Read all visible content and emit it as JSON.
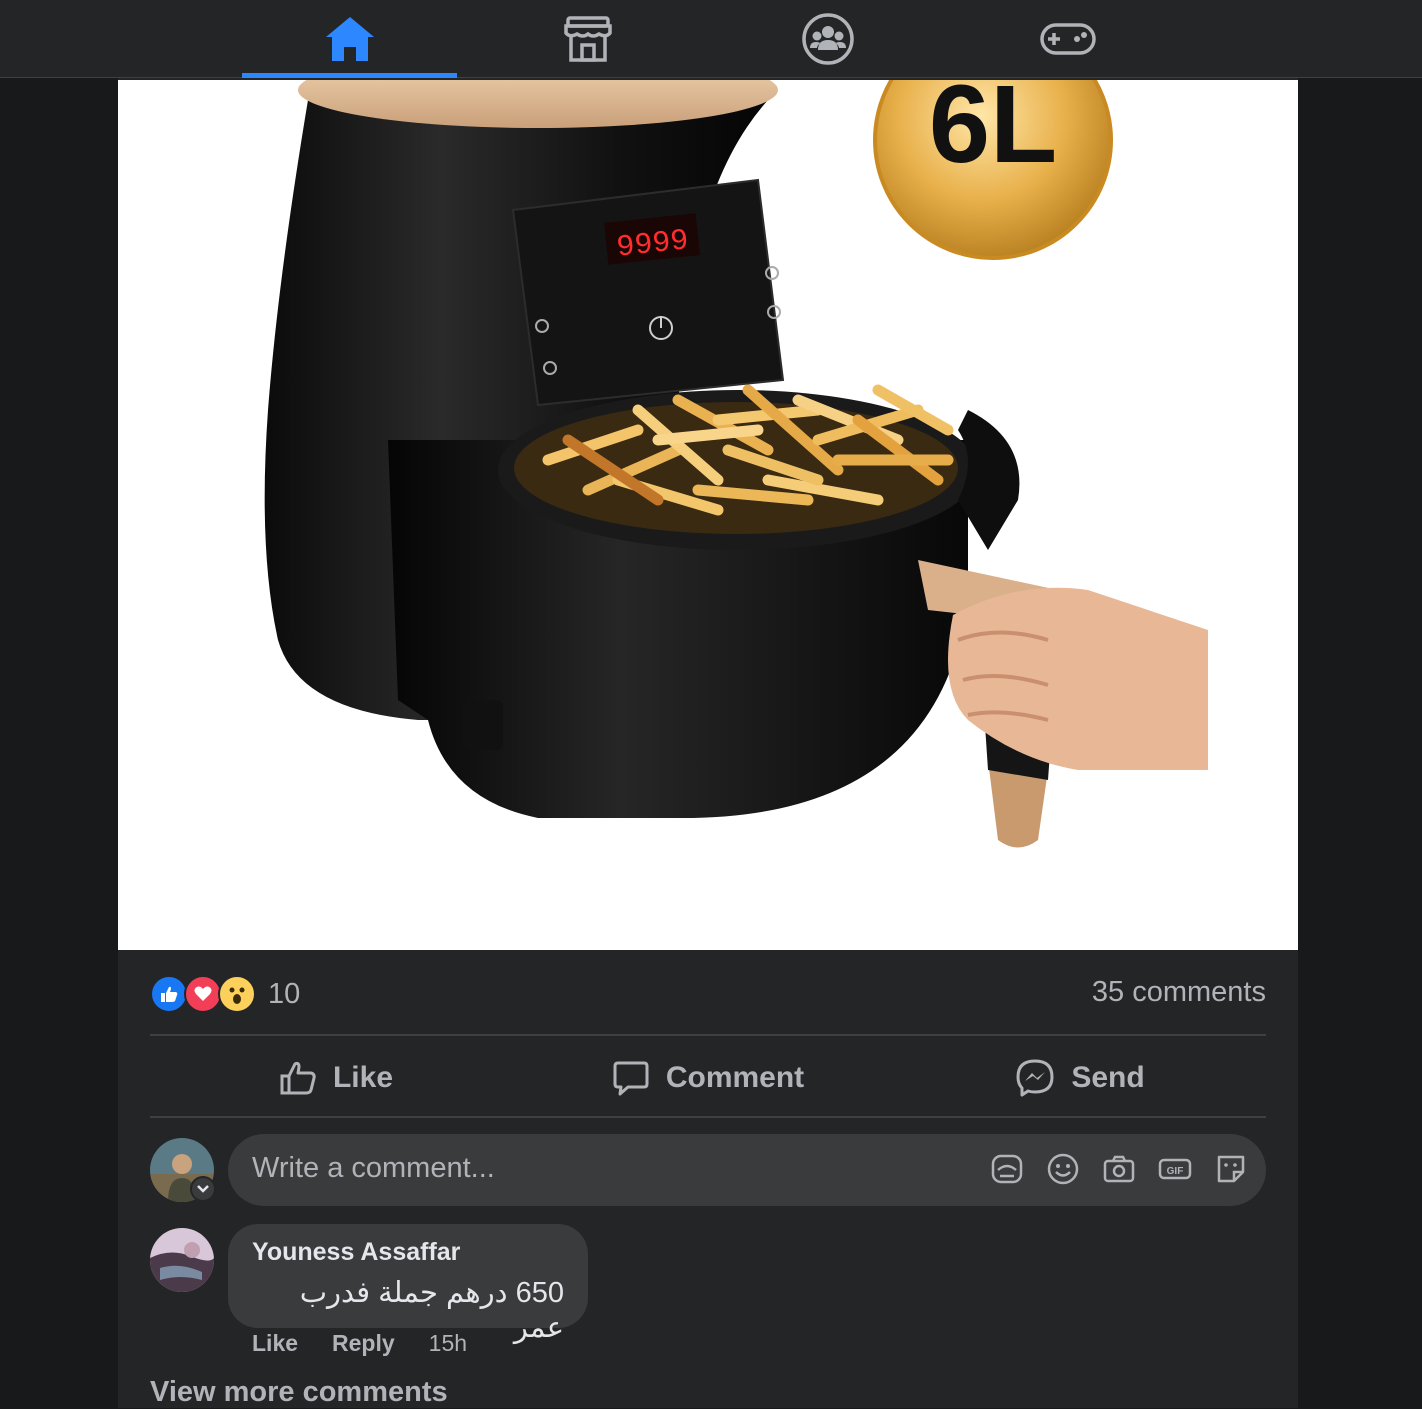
{
  "nav": {
    "tabs": [
      {
        "name": "home",
        "icon": "home-icon",
        "active": true
      },
      {
        "name": "marketplace",
        "icon": "marketplace-store-icon",
        "active": false
      },
      {
        "name": "groups",
        "icon": "groups-icon",
        "active": false
      },
      {
        "name": "gaming",
        "icon": "gaming-controller-icon",
        "active": false
      }
    ],
    "active_color": "#2d88ff"
  },
  "post": {
    "photo": {
      "display_readout": "9999",
      "capacity_badge": "6L"
    },
    "reactions": [
      "like-reaction-icon",
      "love-reaction-icon",
      "wow-reaction-icon"
    ],
    "reaction_count": "10",
    "comments_count": "35 comments",
    "actions": {
      "like": "Like",
      "comment": "Comment",
      "send": "Send"
    }
  },
  "composer": {
    "placeholder": "Write a comment...",
    "icons": [
      "avatar-sticker-icon",
      "emoji-icon",
      "camera-icon",
      "gif-icon",
      "sticker-icon"
    ]
  },
  "comments": [
    {
      "author": "Youness Assaffar",
      "text": "650 درهم جملة فدرب عمر",
      "like": "Like",
      "reply": "Reply",
      "time": "15h"
    }
  ],
  "view_more": "View more comments"
}
